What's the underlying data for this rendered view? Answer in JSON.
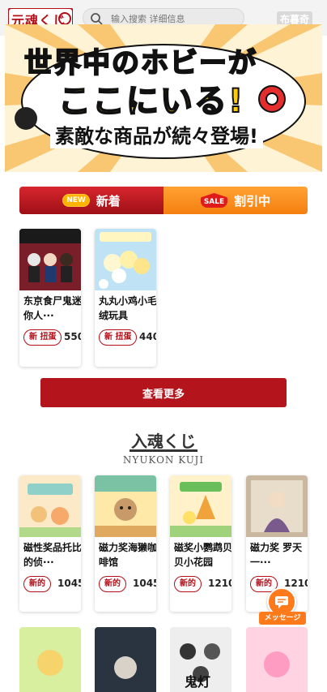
{
  "header": {
    "logo_text": "元魂くじ",
    "search_placeholder": "输入搜索 详细信息",
    "right_label": "布暮奇"
  },
  "banner": {
    "line1": "世界中のホビーが",
    "line2": "ここにいる!",
    "line3": "素敵な商品が続々登場!"
  },
  "tabs": {
    "new_badge": "NEW",
    "new_label": "新着",
    "sale_badge": "SALE",
    "sale_label": "割引中"
  },
  "new_products": [
    {
      "title": "东京食尸鬼迷你人···",
      "badge": "新 扭蛋",
      "price": "550"
    },
    {
      "title": "丸丸小鸡小毛绒玩具",
      "badge": "新 扭蛋",
      "price": "440"
    }
  ],
  "more_button": "查看更多",
  "section": {
    "title": "入魂くじ",
    "subtitle": "NYUKON KUJI"
  },
  "kuji_products": [
    {
      "title": "磁性奖品托比的侦···",
      "badge": "新的",
      "price": "1045"
    },
    {
      "title": "磁力奖海獭咖啡馆",
      "badge": "新的",
      "price": "1045"
    },
    {
      "title": "磁奖小鹦鹉贝贝小花园",
      "badge": "新的",
      "price": "1210"
    },
    {
      "title": "磁力奖 罗天一···",
      "badge": "新的",
      "price": "1210"
    }
  ],
  "bottom_images": {
    "label_4": "鬼灯"
  },
  "message_button": "メッセージ",
  "colors": {
    "brand_red": "#b40f18",
    "sale_orange": "#f57f0f",
    "message_orange": "#ff7a1a"
  }
}
